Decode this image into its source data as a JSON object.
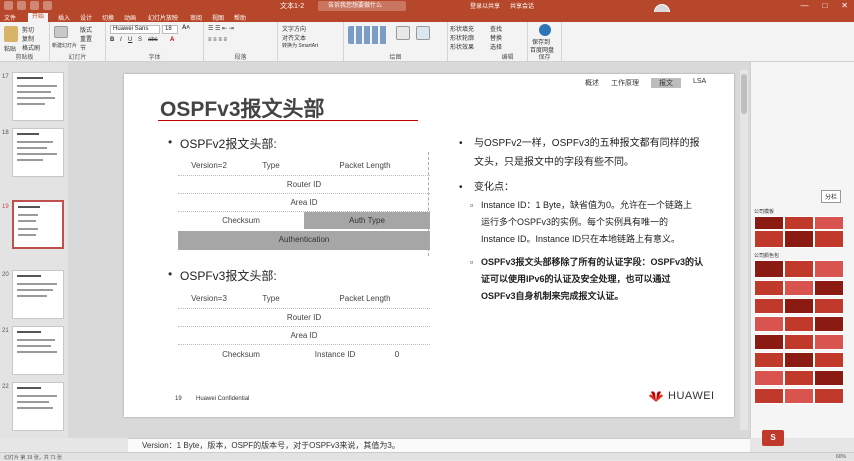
{
  "titlebar": {
    "doc_title": "文本1-2",
    "search_placeholder": "告诉我您想要做什么",
    "login": "登录以共享",
    "share": "共享会话",
    "min": "—",
    "max": "□",
    "close": "✕"
  },
  "tabs": [
    {
      "label": "文件",
      "active": false
    },
    {
      "label": "开始",
      "active": true
    },
    {
      "label": "插入",
      "active": false
    },
    {
      "label": "设计",
      "active": false
    },
    {
      "label": "切换",
      "active": false
    },
    {
      "label": "动画",
      "active": false
    },
    {
      "label": "幻灯片放映",
      "active": false
    },
    {
      "label": "审阅",
      "active": false
    },
    {
      "label": "视图",
      "active": false
    },
    {
      "label": "帮助",
      "active": false
    }
  ],
  "ribbon": {
    "paste": "粘贴",
    "cut": "剪切",
    "copy": "复制",
    "format_painter": "格式刷",
    "clipboard": "剪贴板",
    "new_slide": "新建幻灯片",
    "layout": "版式",
    "reset": "重置",
    "section": "节",
    "slides": "幻灯片",
    "font_name": "Huawei Sans",
    "font_size": "18",
    "font": "字体",
    "paragraph": "段落",
    "text_direction": "文字方向",
    "align_text": "对齐文本",
    "smartart": "转换为 SmartArt",
    "drawing": "绘图",
    "shape_fill": "形状填充",
    "shape_outline": "形状轮廓",
    "shape_effects": "形状效果",
    "find": "查找",
    "replace": "替换",
    "select": "选择",
    "editing": "编辑",
    "save_cloud": "保存到",
    "baidu_cloud": "百度网盘",
    "save": "保存"
  },
  "thumbnails": [
    {
      "num": "17",
      "selected": false
    },
    {
      "num": "18",
      "selected": false
    },
    {
      "num": "19",
      "selected": true
    },
    {
      "num": "20",
      "selected": false
    },
    {
      "num": "21",
      "selected": false
    },
    {
      "num": "22",
      "selected": false
    }
  ],
  "slide": {
    "nav_tabs": [
      "概述",
      "工作原理",
      "报文",
      "LSA"
    ],
    "title": "OSPFv3报文头部",
    "v2_heading": "OSPFv2报文头部:",
    "v2_rows": [
      [
        "Version=2",
        "Type",
        "Packet Length"
      ],
      [
        "Router ID"
      ],
      [
        "Area ID"
      ],
      [
        "Checksum",
        "Auth Type"
      ],
      [
        "Authentication"
      ]
    ],
    "v3_heading": "OSPFv3报文头部:",
    "v3_rows": [
      [
        "Version=3",
        "Type",
        "Packet Length"
      ],
      [
        "Router ID"
      ],
      [
        "Area ID"
      ],
      [
        "Checksum",
        "Instance ID",
        "0"
      ]
    ],
    "right_p1_line1": "与OSPFv2一样，OSPFv3的五种报文都有同样的报",
    "right_p1_line2": "文头，只是报文中的字段有些不同。",
    "changes_heading": "变化点：",
    "sub1_line1": "Instance ID：1 Byte，缺省值为0。允许在一个链路上",
    "sub1_line2": "运行多个OSPFv3的实例。每个实例具有唯一的",
    "sub1_line3": "Instance ID。Instance ID只在本地链路上有意义。",
    "sub2_line1": "OSPFv3报文头部移除了所有的认证字段：OSPFv3的认",
    "sub2_line2": "证可以使用IPv6的认证及安全处理，也可以通过",
    "sub2_line3": "OSPFv3自身机制来完成报文认证。",
    "footer_num": "19",
    "footer_conf": "Huawei Confidential",
    "brand": "HUAWEI"
  },
  "right_panel": {
    "label1": "公司模板",
    "label2": "公司颜色包",
    "button": "分栏"
  },
  "notes": "Version：1 Byte，版本，OSPF的版本号，对于OSPFv3来说，其值为3。",
  "status": {
    "left": "幻灯片 第 19 张，共 71 张",
    "right": "60%"
  },
  "colors": {
    "accent": "#b7472a",
    "huawei_red": "#c00000",
    "gray_cell": "#a6a6a6"
  }
}
